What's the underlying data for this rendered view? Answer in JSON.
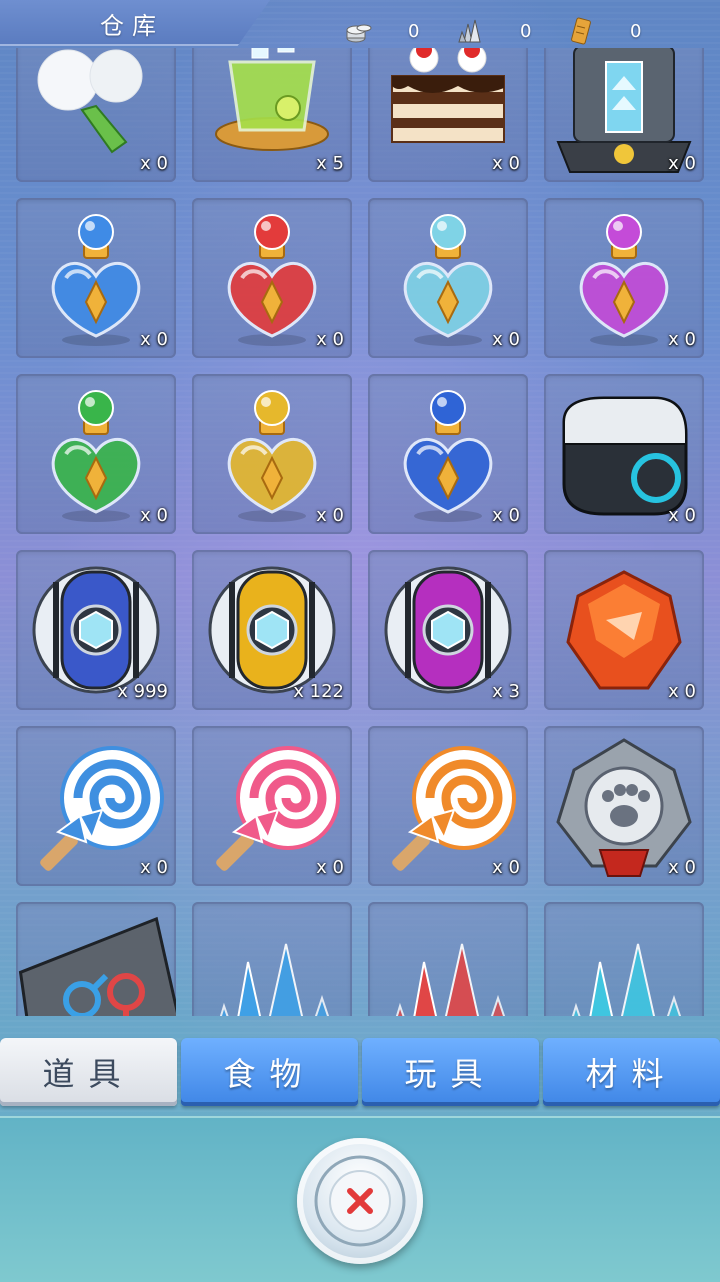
{
  "header": {
    "title": "仓库",
    "currencies": [
      {
        "icon": "coin-stack-icon",
        "value": "0"
      },
      {
        "icon": "crystal-cluster-icon",
        "value": "0"
      },
      {
        "icon": "ticket-icon",
        "value": "0"
      }
    ]
  },
  "items": [
    {
      "icon": "dandelion-flower-icon",
      "qty": "x 0"
    },
    {
      "icon": "green-tea-cup-icon",
      "qty": "x 5"
    },
    {
      "icon": "chocolate-cake-icon",
      "qty": "x 0"
    },
    {
      "icon": "tech-machine-icon",
      "qty": "x 0"
    },
    {
      "icon": "blue-potion-icon",
      "qty": "x 0",
      "color": "#3f8be6"
    },
    {
      "icon": "red-potion-icon",
      "qty": "x 0",
      "color": "#e33b3b"
    },
    {
      "icon": "cyan-potion-icon",
      "qty": "x 0",
      "color": "#7fd3e6"
    },
    {
      "icon": "purple-potion-icon",
      "qty": "x 0",
      "color": "#c44bd8"
    },
    {
      "icon": "green-potion-icon",
      "qty": "x 0",
      "color": "#39b54a"
    },
    {
      "icon": "yellow-potion-icon",
      "qty": "x 0",
      "color": "#e6b82c"
    },
    {
      "icon": "deep-blue-potion-icon",
      "qty": "x 0",
      "color": "#2f64d6"
    },
    {
      "icon": "capsule-device-icon",
      "qty": "x 0"
    },
    {
      "icon": "blue-capture-ball-icon",
      "qty": "x 999",
      "color": "#3a58c9"
    },
    {
      "icon": "gold-capture-ball-icon",
      "qty": "x 122",
      "color": "#e9b21c"
    },
    {
      "icon": "purple-capture-ball-icon",
      "qty": "x 3",
      "color": "#b52fbf"
    },
    {
      "icon": "fire-gem-icon",
      "qty": "x 0"
    },
    {
      "icon": "blue-lollipop-icon",
      "qty": "x 0",
      "color": "#3f8fe0"
    },
    {
      "icon": "pink-lollipop-icon",
      "qty": "x 0",
      "color": "#f05a8a"
    },
    {
      "icon": "orange-lollipop-icon",
      "qty": "x 0",
      "color": "#f08a2a"
    },
    {
      "icon": "paw-badge-icon",
      "qty": "x 0"
    },
    {
      "icon": "gender-ticket-icon",
      "qty": ""
    },
    {
      "icon": "blue-crystal-icon",
      "qty": "",
      "color": "#3fa0e6"
    },
    {
      "icon": "red-crystal-icon",
      "qty": "",
      "color": "#e04646"
    },
    {
      "icon": "cyan-crystal-icon",
      "qty": "",
      "color": "#3fc6e0"
    }
  ],
  "tabs": [
    {
      "label": "道具",
      "active": true
    },
    {
      "label": "食物",
      "active": false
    },
    {
      "label": "玩具",
      "active": false
    },
    {
      "label": "材料",
      "active": false
    }
  ],
  "footer": {
    "close_icon": "close-x-icon"
  }
}
